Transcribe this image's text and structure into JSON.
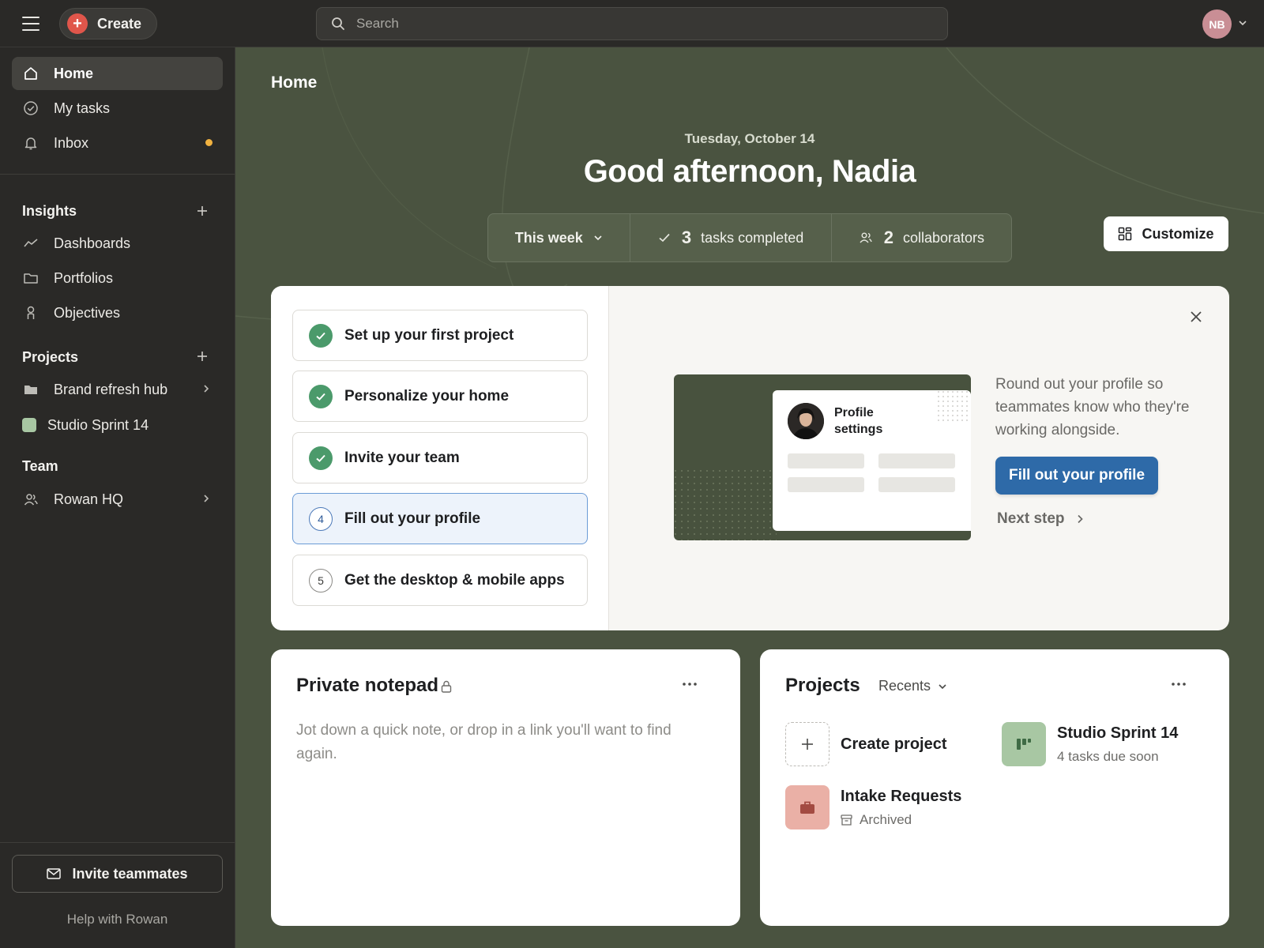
{
  "topbar": {
    "create_label": "Create",
    "search_placeholder": "Search",
    "avatar_initials": "NB",
    "avatar_color": "#c98e95"
  },
  "sidebar": {
    "nav": [
      {
        "label": "Home",
        "icon": "home-icon",
        "active": true
      },
      {
        "label": "My tasks",
        "icon": "check-circle-icon"
      },
      {
        "label": "Inbox",
        "icon": "bell-icon",
        "unread": true
      }
    ],
    "insights": {
      "heading": "Insights",
      "items": [
        {
          "label": "Dashboards",
          "icon": "trend-line-icon"
        },
        {
          "label": "Portfolios",
          "icon": "folder-icon"
        },
        {
          "label": "Objectives",
          "icon": "person-pin-icon"
        }
      ]
    },
    "projects": {
      "heading": "Projects",
      "items": [
        {
          "label": "Brand refresh hub",
          "icon": "folder-filled-icon"
        },
        {
          "label": "Studio Sprint 14",
          "icon": "color-swatch",
          "color": "#a8c7a3"
        }
      ]
    },
    "team": {
      "heading": "Team",
      "items": [
        {
          "label": "Rowan HQ",
          "icon": "people-icon"
        }
      ]
    },
    "invite_label": "Invite teammates",
    "help_label": "Help with Rowan"
  },
  "main": {
    "title": "Home",
    "date": "Tuesday, October 14",
    "greeting": "Good afternoon, Nadia",
    "stats": {
      "period": "This week",
      "tasks_completed_count": "3",
      "tasks_completed_label": "tasks completed",
      "collaborators_count": "2",
      "collaborators_label": "collaborators"
    },
    "customize_label": "Customize",
    "background_color": "#4a5340"
  },
  "onboarding": {
    "steps": [
      {
        "label": "Set up your first project",
        "status": "done"
      },
      {
        "label": "Personalize your home",
        "status": "done"
      },
      {
        "label": "Invite your team",
        "status": "done"
      },
      {
        "label": "Fill out your profile",
        "status": "current",
        "number": "4"
      },
      {
        "label": "Get the desktop & mobile apps",
        "status": "todo",
        "number": "5"
      }
    ],
    "illustration_title": "Profile settings",
    "description": "Round out your profile so teammates know who they're working alongside.",
    "cta_label": "Fill out your profile",
    "next_label": "Next step",
    "accent_color": "#2e6aa8"
  },
  "notepad": {
    "title": "Private notepad",
    "placeholder": "Jot down a quick note, or drop in a link you'll want to find again."
  },
  "projects_widget": {
    "title": "Projects",
    "filter": "Recents",
    "create_label": "Create project",
    "items": [
      {
        "name": "Studio Sprint 14",
        "meta": "4 tasks due soon",
        "color": "#a8c7a3",
        "icon": "board-icon"
      },
      {
        "name": "Intake Requests",
        "meta": "Archived",
        "color": "#eab0a6",
        "icon": "briefcase-icon"
      }
    ]
  }
}
